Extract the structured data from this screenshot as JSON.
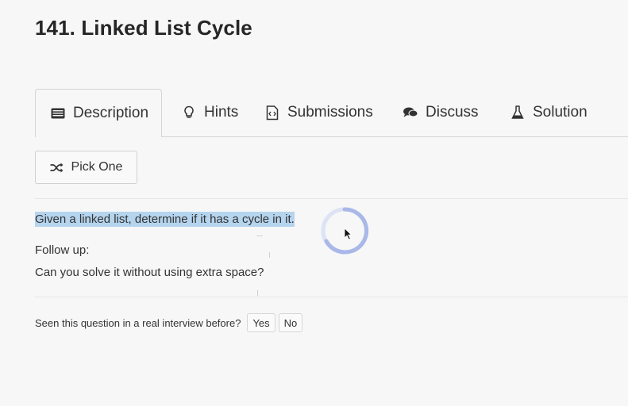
{
  "problem": {
    "title": "141. Linked List Cycle"
  },
  "tabs": [
    {
      "label": "Description",
      "icon": "description-icon",
      "active": true
    },
    {
      "label": "Hints",
      "icon": "lightbulb-icon"
    },
    {
      "label": "Submissions",
      "icon": "code-file-icon"
    },
    {
      "label": "Discuss",
      "icon": "comments-icon"
    },
    {
      "label": "Solution",
      "icon": "flask-icon"
    }
  ],
  "pick_one": {
    "label": "Pick One",
    "icon": "shuffle-icon"
  },
  "content": {
    "description": "Given a linked list, determine if it has a cycle in it.",
    "follow_up_label": "Follow up:",
    "follow_up_question": "Can you solve it without using extra space?"
  },
  "feedback": {
    "prompt": "Seen this question in a real interview before?",
    "yes_label": "Yes",
    "no_label": "No"
  },
  "colors": {
    "selection_highlight": "#b5d4ee",
    "spinner": "#a9b8e8",
    "background": "#f7f7f7"
  }
}
